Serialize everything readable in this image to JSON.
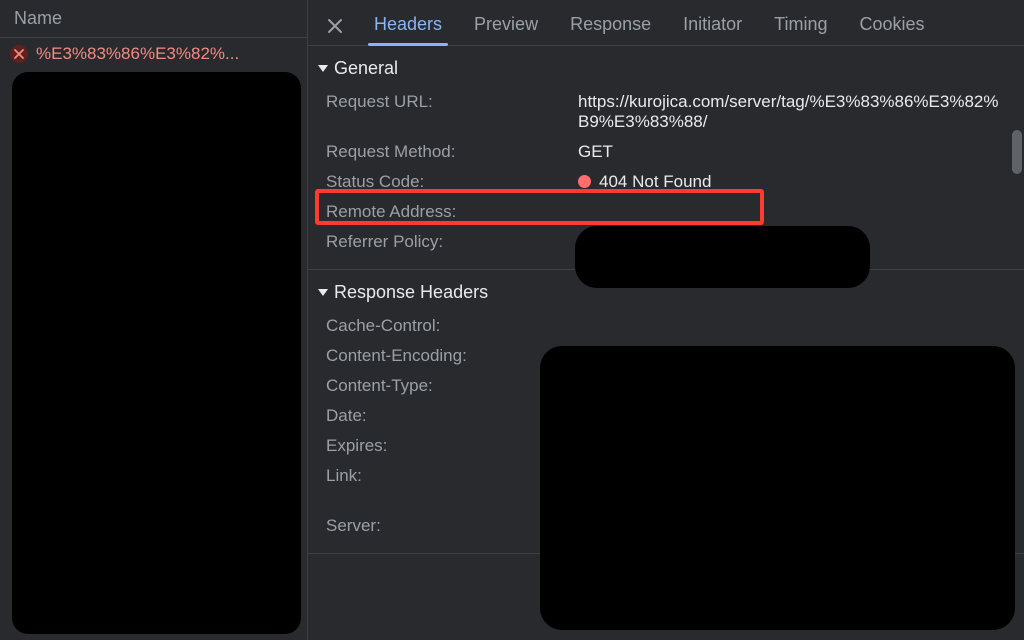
{
  "colors": {
    "status_dot": "#ff6e6e",
    "error_text": "#f28b82",
    "active_tab": "#8ab4f8"
  },
  "left": {
    "header": "Name",
    "request_name": "%E3%83%86%E3%82%..."
  },
  "tabs": {
    "headers": "Headers",
    "preview": "Preview",
    "response": "Response",
    "initiator": "Initiator",
    "timing": "Timing",
    "cookies": "Cookies"
  },
  "sections": {
    "general": {
      "title": "General",
      "rows": {
        "request_url": {
          "label": "Request URL:",
          "value": "https://kurojica.com/server/tag/%E3%83%86%E3%82%B9%E3%83%88/"
        },
        "request_method": {
          "label": "Request Method:",
          "value": "GET"
        },
        "status_code": {
          "label": "Status Code:",
          "value": "404 Not Found"
        },
        "remote_address": {
          "label": "Remote Address:",
          "value": ""
        },
        "referrer_policy": {
          "label": "Referrer Policy:",
          "value": ""
        }
      }
    },
    "response_headers": {
      "title": "Response Headers",
      "rows": {
        "cache_control": {
          "label": "Cache-Control:"
        },
        "content_encoding": {
          "label": "Content-Encoding:"
        },
        "content_type": {
          "label": "Content-Type:"
        },
        "date": {
          "label": "Date:"
        },
        "expires": {
          "label": "Expires:"
        },
        "link": {
          "label": "Link:"
        },
        "server": {
          "label": "Server:"
        }
      }
    }
  }
}
